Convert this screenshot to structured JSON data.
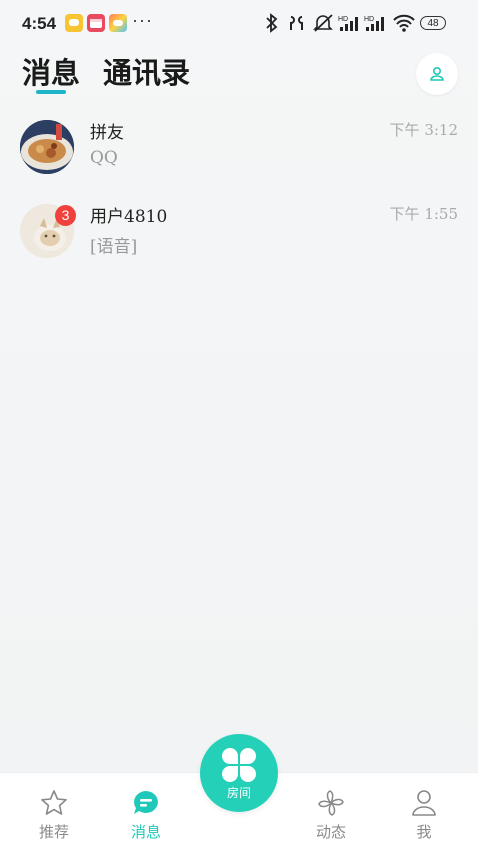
{
  "status_bar": {
    "time": "4:54",
    "more": "···",
    "battery": "48"
  },
  "header": {
    "tabs": [
      {
        "label": "消息",
        "active": true
      },
      {
        "label": "通讯录",
        "active": false
      }
    ],
    "contact_icon": "person-icon"
  },
  "conversations": [
    {
      "name": "拼友",
      "preview": "QQ",
      "time": "下午 3:12",
      "badge": ""
    },
    {
      "name": "用户4810",
      "preview": "[语音]",
      "time": "下午 1:55",
      "badge": "3"
    }
  ],
  "bottom_nav": {
    "items": [
      {
        "label": "推荐",
        "icon": "star-icon",
        "active": false
      },
      {
        "label": "消息",
        "icon": "message-icon",
        "active": true
      },
      {
        "label": "动态",
        "icon": "pinwheel-icon",
        "active": false
      },
      {
        "label": "我",
        "icon": "profile-icon",
        "active": false
      }
    ],
    "center": {
      "label": "房间",
      "icon": "clover-icon"
    }
  },
  "colors": {
    "accent": "#24d1b8",
    "tab_underline": "#1fb5c8",
    "badge": "#f0413d"
  }
}
